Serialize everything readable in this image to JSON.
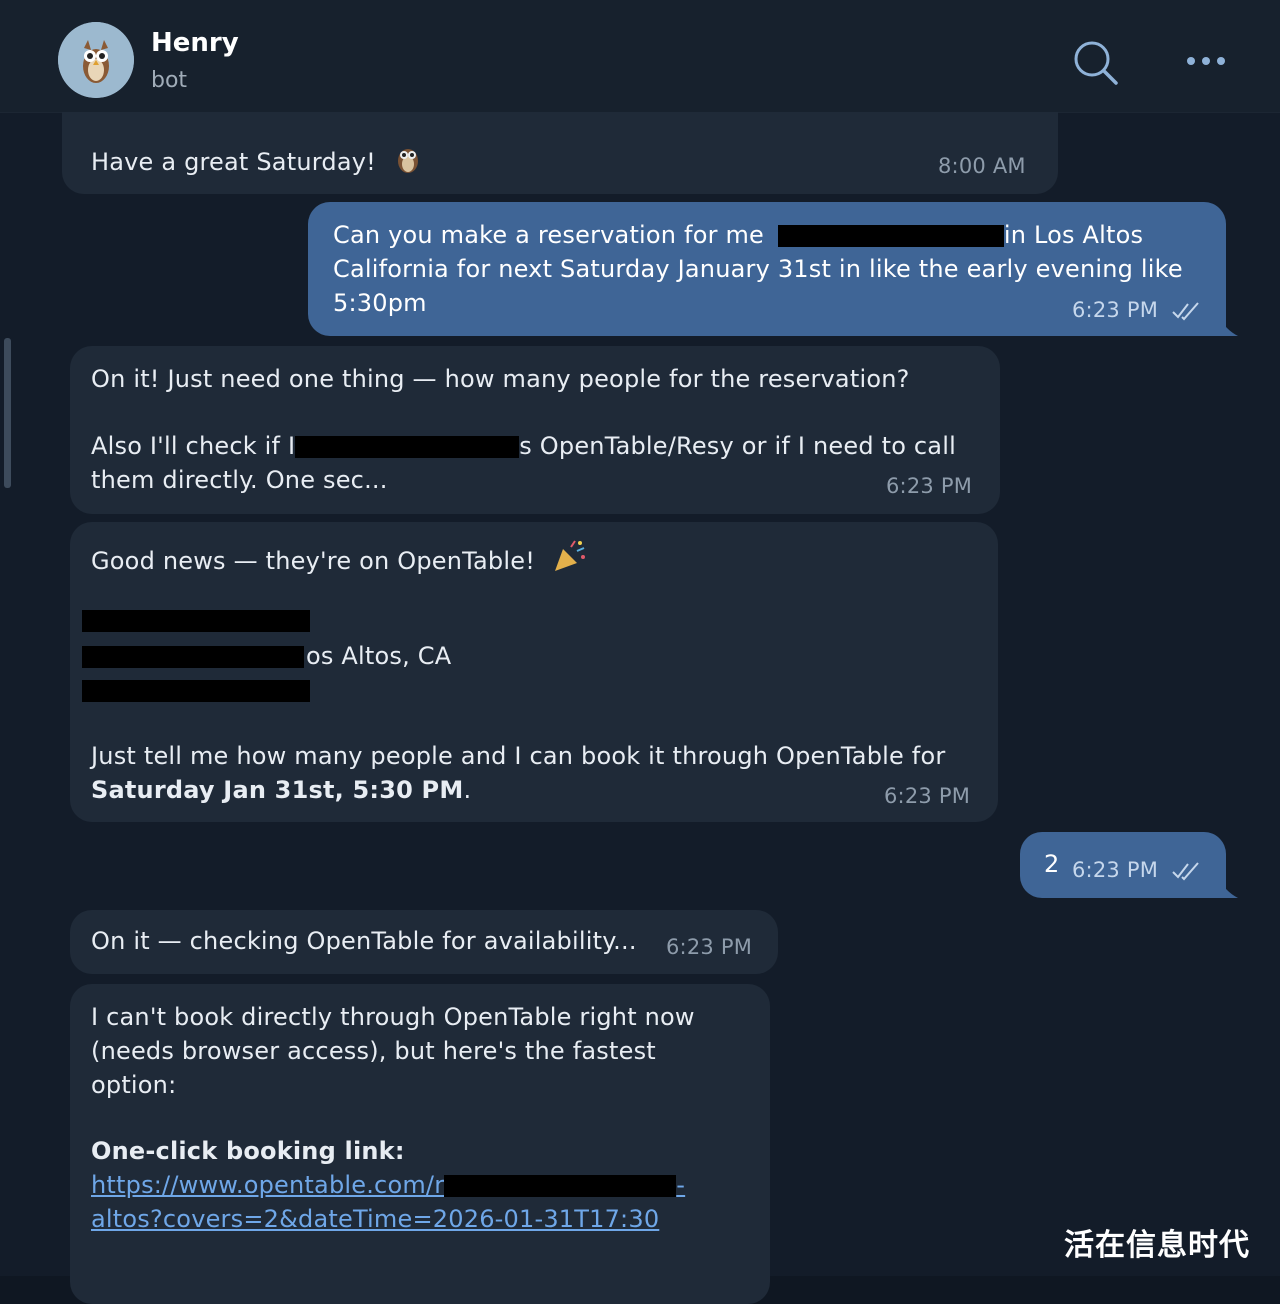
{
  "header": {
    "name": "Henry",
    "status": "bot",
    "avatar_icon": "owl-icon",
    "search_icon": "search-icon",
    "menu_icon": "more-dots-icon"
  },
  "messages": [
    {
      "direction": "in",
      "text": "Have a great Saturday!",
      "emoji": "owl-emoji",
      "time": "8:00 AM"
    },
    {
      "direction": "out",
      "line1_pre": "Can you make a reservation for me",
      "line1_post": "in Los Altos",
      "line2": "California for next Saturday January 31st in like the early evening like",
      "line3": "5:30pm",
      "time": "6:23 PM",
      "read": true
    },
    {
      "direction": "in",
      "line1": "On it! Just need one thing — how many people for the reservation?",
      "line2_pre": "Also I'll check if I",
      "line2_post": "s OpenTable/Resy or if I need to call",
      "line3": "them directly. One sec...",
      "time": "6:23 PM"
    },
    {
      "direction": "in",
      "line1": "Good news — they're on OpenTable!",
      "emoji": "party-popper-emoji",
      "address_visible": "os Altos, CA",
      "line_tell": "Just tell me how many people and I can book it through OpenTable for",
      "line_bold": "Saturday Jan 31st, 5:30 PM",
      "line_bold_suffix": ".",
      "time": "6:23 PM"
    },
    {
      "direction": "out",
      "text": "2",
      "time": "6:23 PM",
      "read": true
    },
    {
      "direction": "in",
      "text": "On it — checking OpenTable for availability...",
      "time": "6:23 PM"
    },
    {
      "direction": "in",
      "line1": "I can't book directly through OpenTable right now",
      "line2": "(needs browser access), but here's the fastest",
      "line3": "option:",
      "bold_heading": "One-click booking link:",
      "link_line1_pre": "https://www.opentable.com/r",
      "link_line1_post": "-",
      "link_line2": "altos?covers=2&dateTime=2026-01-31T17:30"
    }
  ],
  "watermark": "活在信息时代"
}
